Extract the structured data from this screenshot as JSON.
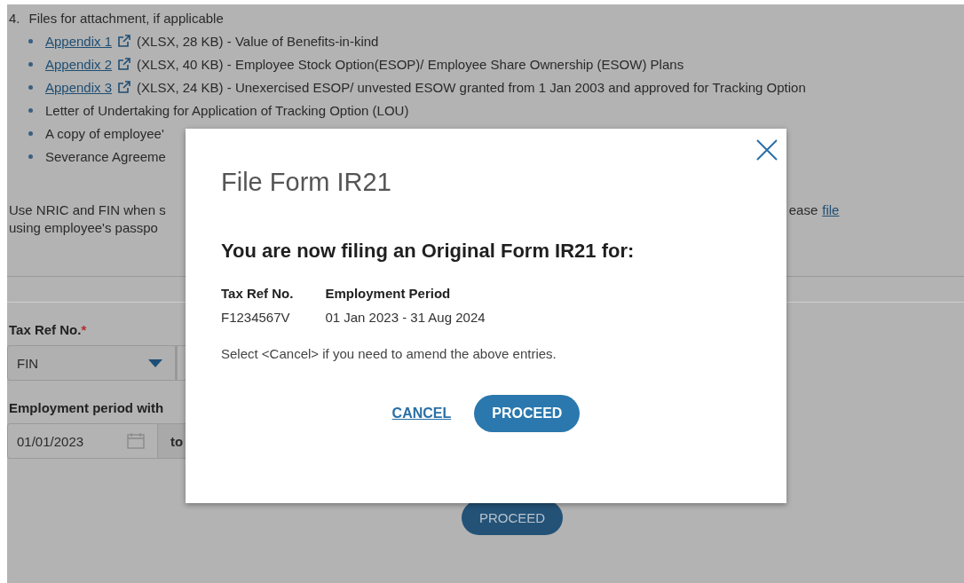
{
  "page": {
    "section_heading": {
      "number": "4.",
      "text": "Files for attachment, if applicable"
    },
    "attachments": [
      {
        "kind": "link",
        "link": "Appendix 1",
        "details": "(XLSX, 28 KB) - Value of Benefits-in-kind"
      },
      {
        "kind": "link",
        "link": "Appendix 2",
        "details": "(XLSX, 40 KB) - Employee Stock Option(ESOP)/ Employee Share Ownership (ESOW) Plans"
      },
      {
        "kind": "link",
        "link": "Appendix 3",
        "details": "(XLSX, 24 KB) - Unexercised ESOP/ unvested ESOW granted from 1 Jan 2003 and approved for Tracking Option"
      },
      {
        "kind": "text",
        "text": "Letter of Undertaking for Application of Tracking Option (LOU)"
      },
      {
        "kind": "text",
        "text": "A copy of employee'"
      },
      {
        "kind": "text",
        "text": "Severance Agreeme"
      }
    ],
    "note": {
      "line_1": "Use NRIC and FIN when s",
      "line_1_right": "ease",
      "line_1_link": "file",
      "line_2": "using employee's passpo"
    },
    "tax_ref": {
      "label": "Tax Ref No.",
      "required_mark": "*",
      "id_type": "FIN"
    },
    "employment_period": {
      "label": "Employment period with",
      "start_date": "01/01/2023",
      "separator": "to"
    },
    "proceed_button": "PROCEED"
  },
  "dialog": {
    "title": "File Form IR21",
    "heading": "You are now filing an Original Form IR21 for:",
    "columns": [
      {
        "header": "Tax Ref No.",
        "value": "F1234567V"
      },
      {
        "header": "Employment Period",
        "value": "01 Jan 2023 - 31 Aug 2024"
      }
    ],
    "note": "Select <Cancel> if you need to amend the above entries.",
    "cancel": "CANCEL",
    "proceed": "PROCEED"
  }
}
